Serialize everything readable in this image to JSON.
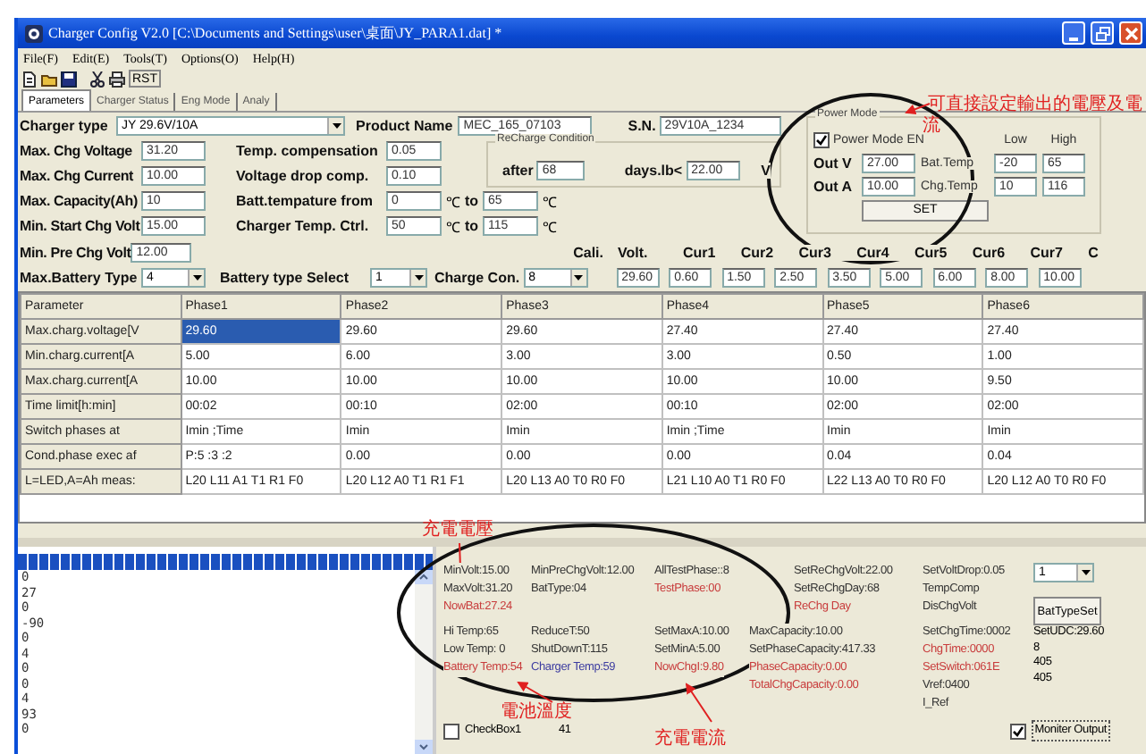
{
  "window": {
    "title": "Charger Config V2.0 [C:\\Documents and Settings\\user\\桌面\\JY_PARA1.dat] *"
  },
  "menu": [
    "File(F)",
    "Edit(E)",
    "Tools(T)",
    "Options(O)",
    "Help(H)"
  ],
  "toolbar": {
    "reset_label": "RST"
  },
  "tabs": [
    {
      "label": "Parameters",
      "selected": true
    },
    {
      "label": "Charger Status",
      "selected": false
    },
    {
      "label": "Eng Mode",
      "selected": false
    },
    {
      "label": "Analy",
      "selected": false
    }
  ],
  "header_fields": [
    {
      "label": "Charger type",
      "value": "JY 29.6V/10A",
      "kind": "combo"
    },
    {
      "label": "Product Name",
      "value": "MEC_165_07103",
      "kind": "text"
    },
    {
      "label": "S.N.",
      "value": "29V10A_1234",
      "kind": "text"
    }
  ],
  "left_fields": [
    {
      "label": "Max. Chg Voltage",
      "value": "31.20"
    },
    {
      "label": "Max. Chg Current",
      "value": "10.00"
    },
    {
      "label": "Max. Capacity(Ah)",
      "value": "10"
    },
    {
      "label": "Min. Start Chg Volt",
      "value": "15.00"
    }
  ],
  "middle_fields": [
    {
      "label": "Temp. compensation",
      "value": "0.05"
    },
    {
      "label": "Voltage drop comp.",
      "value": "0.10"
    }
  ],
  "range_fields": [
    {
      "label": "Batt.tempature from",
      "value": "0",
      "unit": "℃",
      "to_label": "to",
      "to_value": "65",
      "to_unit": "℃"
    },
    {
      "label": "Charger Temp. Ctrl.",
      "value": "50",
      "unit": "℃",
      "to_label": "to",
      "to_value": "115",
      "to_unit": "℃"
    }
  ],
  "recharge": {
    "title": "ReCharge Condition",
    "after_label": "after",
    "after_value": "68",
    "days_label": "days.lb<",
    "days_value": "22.00",
    "unit": "V"
  },
  "power_mode": {
    "title": "Power Mode",
    "enable": {
      "label": "Power Mode EN",
      "checked": true
    },
    "low_label": "Low",
    "high_label": "High",
    "rows": [
      {
        "label": "Out V",
        "value": "27.00",
        "temp_label": "Bat.Temp",
        "low": "-20",
        "high": "65"
      },
      {
        "label": "Out A",
        "value": "10.00",
        "temp_label": "Chg.Temp",
        "low": "10",
        "high": "116"
      }
    ],
    "set_button": "SET"
  },
  "pre_chg": {
    "label": "Min. Pre Chg Volt",
    "value": "12.00"
  },
  "combos": [
    {
      "label": "Max.Battery Type",
      "value": "4"
    },
    {
      "label": "Battery type Select",
      "value": "1"
    },
    {
      "label": "Charge Con.",
      "value": "8"
    }
  ],
  "cali_label": "Cali.",
  "cali_headers": [
    "Volt.",
    "Cur1",
    "Cur2",
    "Cur3",
    "Cur4",
    "Cur5",
    "Cur6",
    "Cur7",
    "C"
  ],
  "cali_values": [
    "29.60",
    "0.60",
    "1.50",
    "2.50",
    "3.50",
    "5.00",
    "6.00",
    "8.00",
    "10.00"
  ],
  "table": {
    "columns": [
      "Parameter",
      "Phase1",
      "Phase2",
      "Phase3",
      "Phase4",
      "Phase5",
      "Phase6"
    ],
    "rows": [
      {
        "cells": [
          {
            "text": "Max.charg.voltage[V",
            "selected": false
          },
          {
            "text": "29.60",
            "selected": true
          },
          {
            "text": "29.60",
            "selected": false
          },
          {
            "text": "29.60",
            "selected": false
          },
          {
            "text": "27.40",
            "selected": false
          },
          {
            "text": "27.40",
            "selected": false
          },
          {
            "text": "27.40",
            "selected": false
          }
        ]
      },
      {
        "cells": [
          {
            "text": "Min.charg.current[A",
            "selected": false
          },
          {
            "text": "5.00",
            "selected": false
          },
          {
            "text": "6.00",
            "selected": false
          },
          {
            "text": "3.00",
            "selected": false
          },
          {
            "text": "3.00",
            "selected": false
          },
          {
            "text": "0.50",
            "selected": false
          },
          {
            "text": "1.00",
            "selected": false
          }
        ]
      },
      {
        "cells": [
          {
            "text": "Max.charg.current[A",
            "selected": false
          },
          {
            "text": "10.00",
            "selected": false
          },
          {
            "text": "10.00",
            "selected": false
          },
          {
            "text": "10.00",
            "selected": false
          },
          {
            "text": "10.00",
            "selected": false
          },
          {
            "text": "10.00",
            "selected": false
          },
          {
            "text": "9.50",
            "selected": false
          }
        ]
      },
      {
        "cells": [
          {
            "text": "Time limit[h:min]",
            "selected": false
          },
          {
            "text": "00:02",
            "selected": false
          },
          {
            "text": "00:10",
            "selected": false
          },
          {
            "text": "02:00",
            "selected": false
          },
          {
            "text": "00:10",
            "selected": false
          },
          {
            "text": "02:00",
            "selected": false
          },
          {
            "text": "02:00",
            "selected": false
          }
        ]
      },
      {
        "cells": [
          {
            "text": "Switch phases at",
            "selected": false
          },
          {
            "text": "Imin ;Time",
            "selected": false
          },
          {
            "text": "Imin",
            "selected": false
          },
          {
            "text": "Imin",
            "selected": false
          },
          {
            "text": "Imin ;Time",
            "selected": false
          },
          {
            "text": "Imin",
            "selected": false
          },
          {
            "text": "Imin",
            "selected": false
          }
        ]
      },
      {
        "cells": [
          {
            "text": "Cond.phase exec af",
            "selected": false
          },
          {
            "text": "P:5 :3 :2",
            "selected": false
          },
          {
            "text": "0.00",
            "selected": false
          },
          {
            "text": "0.00",
            "selected": false
          },
          {
            "text": "0.00",
            "selected": false
          },
          {
            "text": "0.04",
            "selected": false
          },
          {
            "text": "0.04",
            "selected": false
          }
        ]
      },
      {
        "cells": [
          {
            "text": "L=LED,A=Ah meas:",
            "selected": false
          },
          {
            "text": "L20 L11 A1 T1 R1 F0",
            "selected": false
          },
          {
            "text": "L20 L12 A0 T1 R1 F1",
            "selected": false
          },
          {
            "text": "L20 L13 A0 T0 R0 F0",
            "selected": false
          },
          {
            "text": "L21 L10 A0 T1 R0 F0",
            "selected": false
          },
          {
            "text": "L22 L13 A0 T0 R0 F0",
            "selected": false
          },
          {
            "text": "L20 L12 A0 T0 R0 F0",
            "selected": false
          }
        ]
      }
    ]
  },
  "monitor": {
    "progress": {
      "level": 1
    },
    "log_values": [
      "0",
      "27",
      "0",
      "-90",
      "0",
      "4",
      "0",
      "0",
      "4",
      "93",
      "0"
    ],
    "status_columns": [
      {
        "upper": [
          {
            "text": "MinVolt:15.00",
            "color": "#333333"
          },
          {
            "text": "MaxVolt:31.20",
            "color": "#333333"
          },
          {
            "text": "NowBat:27.24",
            "color": "#c83c3c"
          }
        ],
        "lower": [
          {
            "text": "Hi Temp:65",
            "color": "#333333"
          },
          {
            "text": "Low Temp: 0",
            "color": "#333333"
          },
          {
            "text": "Battery Temp:54",
            "color": "#c83c3c"
          }
        ]
      },
      {
        "upper": [
          {
            "text": "MinPreChgVolt:12.00",
            "color": "#333333"
          },
          {
            "text": "BatType:04",
            "color": "#333333"
          }
        ],
        "lower": [
          {
            "text": "ReduceT:50",
            "color": "#333333"
          },
          {
            "text": "ShutDownT:115",
            "color": "#333333"
          },
          {
            "text": "Charger Temp:59",
            "color": "#3c3ca0"
          }
        ]
      },
      {
        "upper": [
          {
            "text": "AllTestPhase::8",
            "color": "#333333"
          },
          {
            "text": "TestPhase:00",
            "color": "#c83c3c"
          }
        ],
        "lower": [
          {
            "text": "SetMaxA:10.00",
            "color": "#333333"
          },
          {
            "text": "SetMinA:5.00",
            "color": "#333333"
          },
          {
            "text": "NowChgI:9.80",
            "color": "#c83c3c"
          }
        ]
      },
      {
        "upper": [
          {
            "text": "SetReChgVolt:22.00",
            "color": "#333333"
          },
          {
            "text": "SetReChgDay:68",
            "color": "#333333"
          },
          {
            "text": "ReChg Day",
            "color": "#c83c3c"
          }
        ],
        "lower": [
          {
            "text": "MaxCapacity:10.00",
            "color": "#333333"
          },
          {
            "text": "SetPhaseCapacity:417.33",
            "color": "#333333"
          },
          {
            "text": "PhaseCapacity:0.00",
            "color": "#c83c3c"
          },
          {
            "text": "TotalChgCapacity:0.00",
            "color": "#c83c3c"
          }
        ]
      },
      {
        "upper": [
          {
            "text": "SetVoltDrop:0.05",
            "color": "#333333"
          },
          {
            "text": "TempComp",
            "color": "#333333"
          },
          {
            "text": "DisChgVolt",
            "color": "#333333"
          }
        ],
        "lower": [
          {
            "text": "SetChgTime:0002",
            "color": "#333333"
          },
          {
            "text": "ChgTime:0000",
            "color": "#c83c3c"
          },
          {
            "text": "SetSwitch:061E",
            "color": "#c83c3c"
          },
          {
            "text": "Vref:0400",
            "color": "#333333"
          },
          {
            "text": "I_Ref",
            "color": "#333333"
          }
        ]
      }
    ],
    "side": {
      "combo_value": "1",
      "button": "BatTypeSet",
      "readings": [
        "SetUDC:29.60",
        "8",
        "405",
        "405"
      ]
    },
    "checkbox": {
      "label": "CheckBox1",
      "checked": false
    },
    "counter": "41",
    "monitor_output": {
      "label": "Moniter Output",
      "checked": true
    }
  },
  "annotations": [
    "可直接設定輸出的電壓及電",
    "流",
    "充電電壓",
    "電池溫度",
    "充電電流"
  ]
}
